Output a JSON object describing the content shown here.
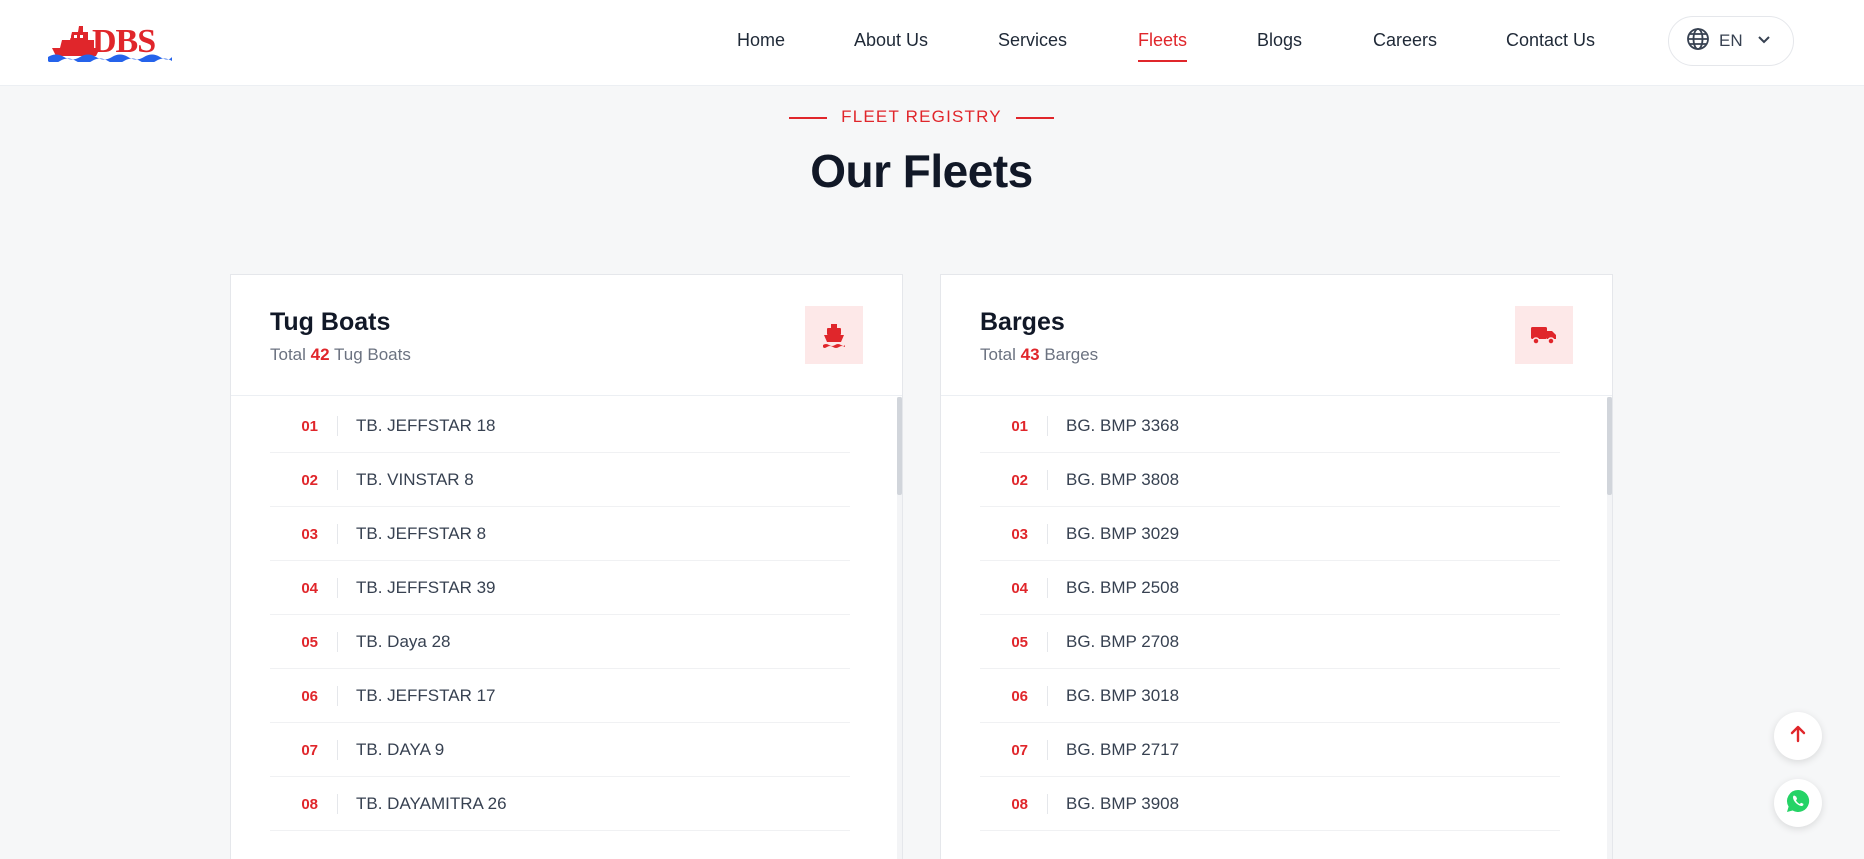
{
  "brand": {
    "logo_text": "DBS",
    "accent": "#e0262b"
  },
  "nav": {
    "items": [
      {
        "label": "Home",
        "active": false
      },
      {
        "label": "About Us",
        "active": false
      },
      {
        "label": "Services",
        "active": false
      },
      {
        "label": "Fleets",
        "active": true
      },
      {
        "label": "Blogs",
        "active": false
      },
      {
        "label": "Careers",
        "active": false
      },
      {
        "label": "Contact Us",
        "active": false
      }
    ],
    "language": {
      "icon": "globe-icon",
      "label": "EN",
      "chevron": "chevron-down-icon"
    }
  },
  "section": {
    "eyebrow": "FLEET REGISTRY",
    "title": "Our Fleets"
  },
  "tugboats": {
    "title": "Tug Boats",
    "total_prefix": "Total",
    "total": "42",
    "total_suffix": "Tug Boats",
    "icon": "ship-icon",
    "items": [
      {
        "num": "01",
        "name": "TB. JEFFSTAR 18"
      },
      {
        "num": "02",
        "name": "TB. VINSTAR 8"
      },
      {
        "num": "03",
        "name": "TB. JEFFSTAR 8"
      },
      {
        "num": "04",
        "name": "TB. JEFFSTAR 39"
      },
      {
        "num": "05",
        "name": "TB. Daya 28"
      },
      {
        "num": "06",
        "name": "TB. JEFFSTAR 17"
      },
      {
        "num": "07",
        "name": "TB. DAYA 9"
      },
      {
        "num": "08",
        "name": "TB. DAYAMITRA 26"
      }
    ]
  },
  "barges": {
    "title": "Barges",
    "total_prefix": "Total",
    "total": "43",
    "total_suffix": "Barges",
    "icon": "truck-icon",
    "items": [
      {
        "num": "01",
        "name": "BG. BMP 3368"
      },
      {
        "num": "02",
        "name": "BG. BMP 3808"
      },
      {
        "num": "03",
        "name": "BG. BMP 3029"
      },
      {
        "num": "04",
        "name": "BG. BMP 2508"
      },
      {
        "num": "05",
        "name": "BG. BMP 2708"
      },
      {
        "num": "06",
        "name": "BG. BMP 3018"
      },
      {
        "num": "07",
        "name": "BG. BMP 2717"
      },
      {
        "num": "08",
        "name": "BG. BMP 3908"
      }
    ]
  },
  "floating": {
    "scroll_top_icon": "arrow-up-icon",
    "whatsapp_icon": "whatsapp-icon"
  }
}
